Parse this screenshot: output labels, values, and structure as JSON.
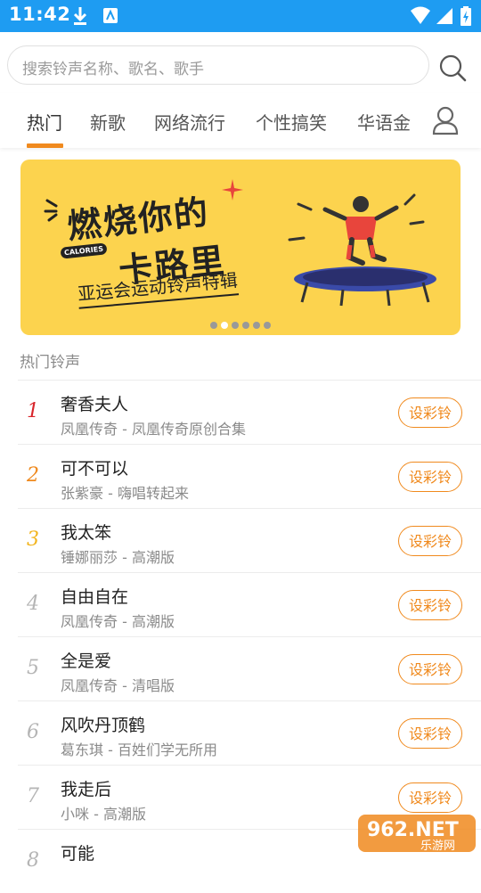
{
  "status_bar": {
    "time": "11:42"
  },
  "search": {
    "placeholder": "搜索铃声名称、歌名、歌手"
  },
  "tabs": [
    {
      "label": "热门",
      "active": true
    },
    {
      "label": "新歌"
    },
    {
      "label": "网络流行"
    },
    {
      "label": "个性搞笑"
    },
    {
      "label": "华语金"
    }
  ],
  "banner": {
    "line1": "燃烧你的",
    "line2": "卡路里",
    "line3": "亚运会运动铃声特辑",
    "badge": "CALORIES",
    "carousel_total": 6,
    "carousel_active": 2
  },
  "section_title": "热门铃声",
  "button_label": "设彩铃",
  "songs": [
    {
      "rank": "1",
      "title": "奢香夫人",
      "sub": "凤凰传奇 - 凤凰传奇原创合集",
      "rank_color": "#d8252b"
    },
    {
      "rank": "2",
      "title": "可不可以",
      "sub": "张紫豪 - 嗨唱转起来",
      "rank_color": "#ef8a1f"
    },
    {
      "rank": "3",
      "title": "我太笨",
      "sub": "锤娜丽莎 - 高潮版",
      "rank_color": "#f2b51f"
    },
    {
      "rank": "4",
      "title": "自由自在",
      "sub": "凤凰传奇 - 高潮版",
      "rank_color": "#b5b5b5"
    },
    {
      "rank": "5",
      "title": "全是爱",
      "sub": "凤凰传奇 - 清唱版",
      "rank_color": "#b5b5b5"
    },
    {
      "rank": "6",
      "title": "风吹丹顶鹤",
      "sub": "葛东琪 - 百姓们学无所用",
      "rank_color": "#b5b5b5"
    },
    {
      "rank": "7",
      "title": "我走后",
      "sub": "小咪 - 高潮版",
      "rank_color": "#b5b5b5"
    },
    {
      "rank": "8",
      "title": "可能",
      "sub": "",
      "rank_color": "#b5b5b5"
    }
  ],
  "watermark": {
    "main": "962.NET",
    "sub": "乐游网"
  },
  "colors": {
    "accent": "#f08a1e",
    "status_bar": "#1e9cf2",
    "banner": "#fcd34e"
  }
}
